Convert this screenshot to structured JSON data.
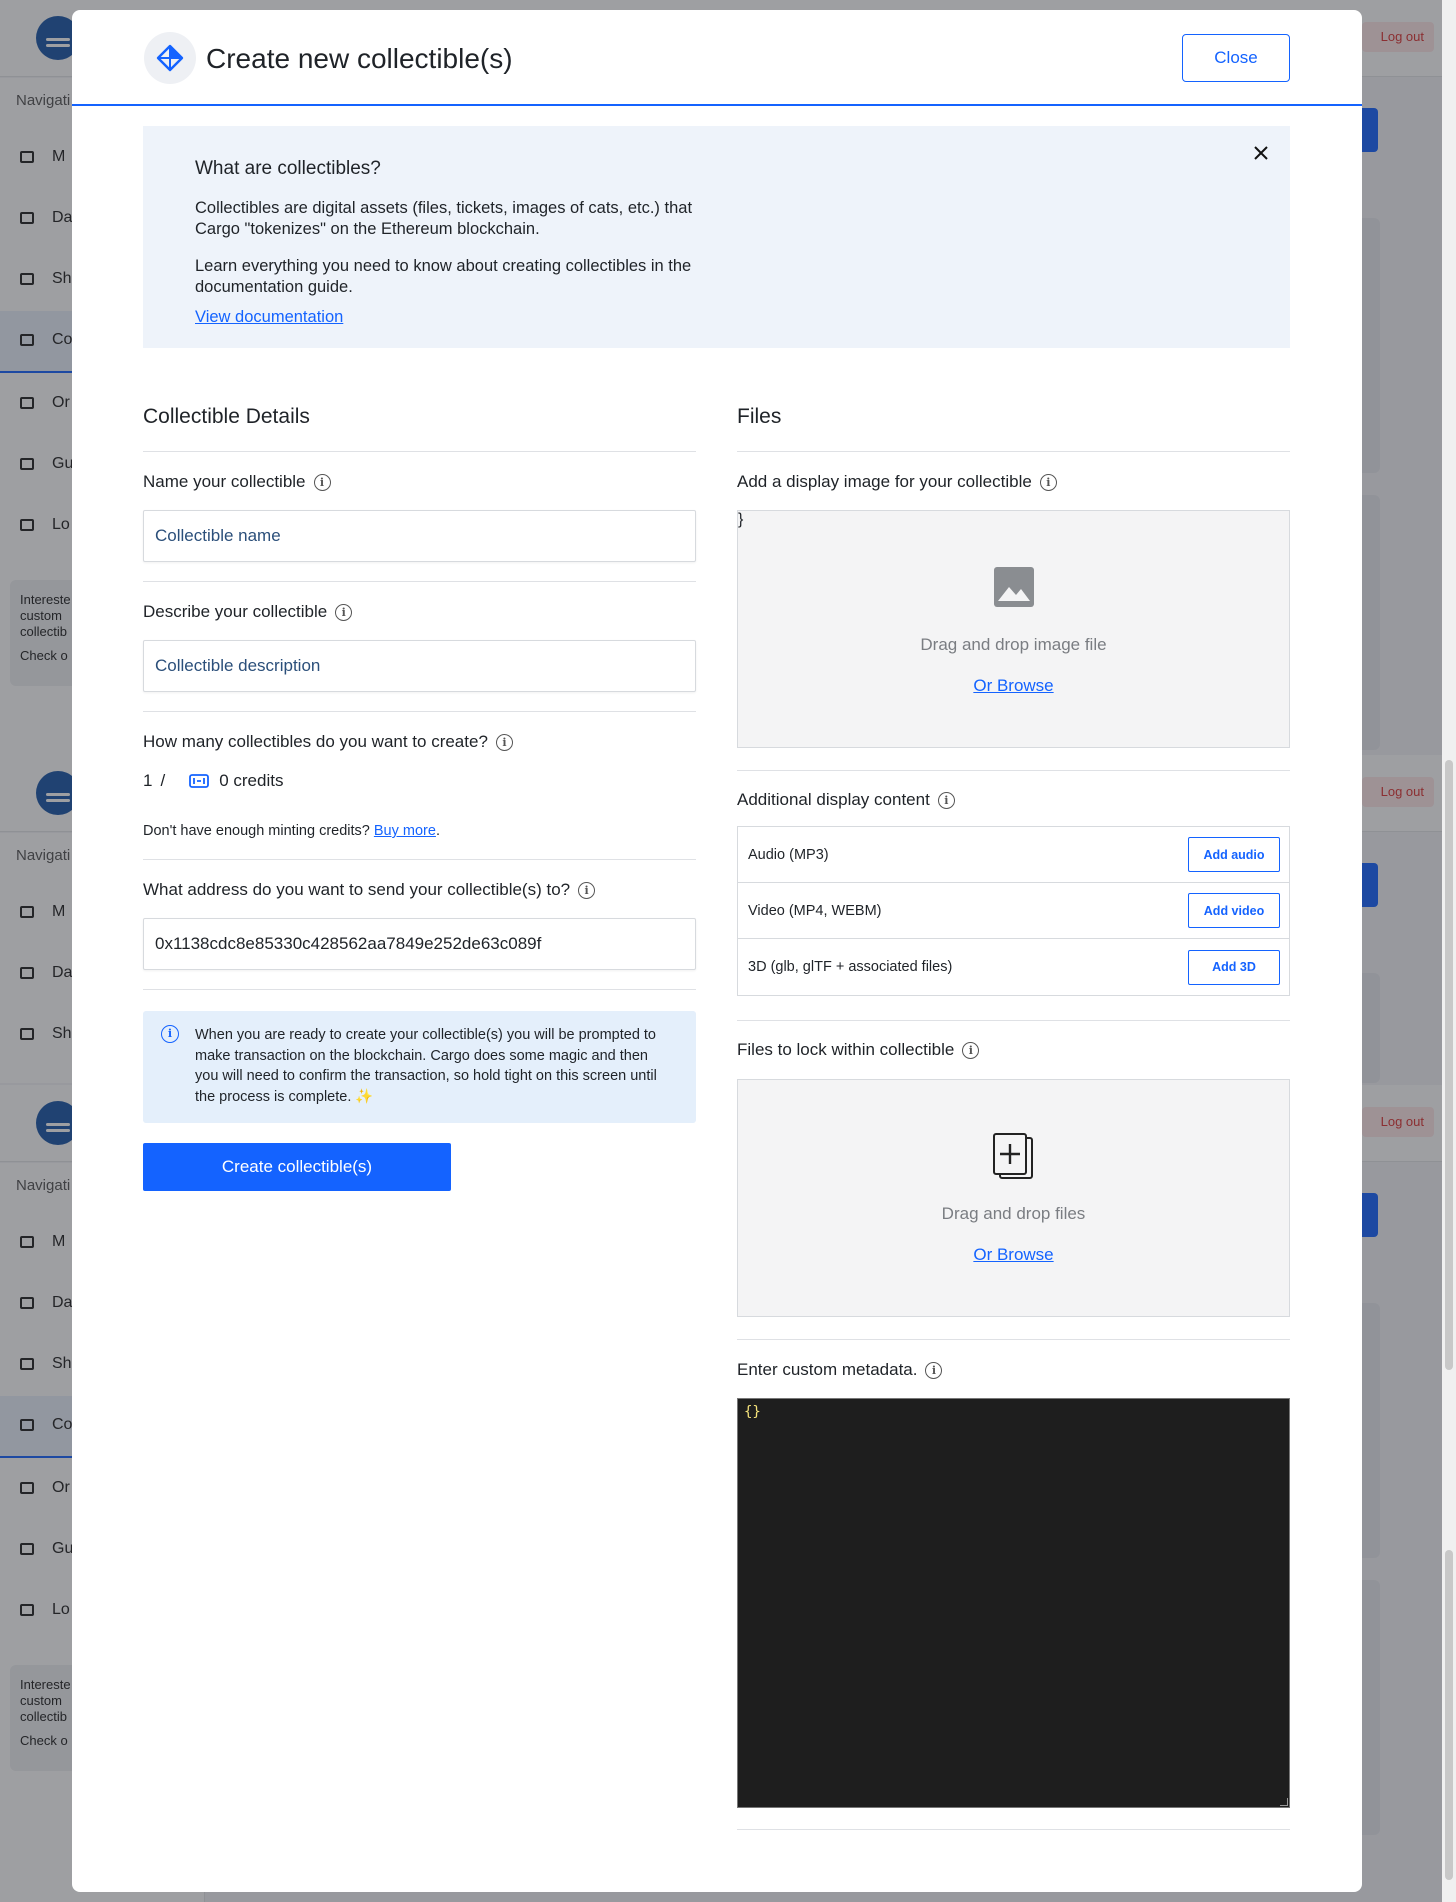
{
  "background": {
    "nav_title": "Navigati",
    "logout_label": "Log out",
    "nav_items": [
      "M",
      "Da",
      "Sh",
      "Co",
      "Or",
      "Gu",
      "Lo"
    ],
    "promo_lines": [
      "Intereste",
      "custom",
      "collectib",
      "Check o"
    ]
  },
  "modal": {
    "title": "Create new collectible(s)",
    "close_label": "Close"
  },
  "info": {
    "title": "What are collectibles?",
    "paragraph_1": "Collectibles are digital assets (files, tickets, images of cats, etc.) that Cargo \"tokenizes\" on the Ethereum blockchain.",
    "paragraph_2": "Learn everything you need to know about creating collectibles in the documentation guide.",
    "link": "View documentation"
  },
  "details": {
    "section_title": "Collectible Details",
    "name_label": "Name your collectible",
    "name_placeholder": "Collectible name",
    "name_value": "",
    "description_label": "Describe your collectible",
    "description_placeholder": "Collectible description",
    "description_value": "",
    "quantity_label": "How many collectibles do you want to create?",
    "quantity_value": "1",
    "quantity_separator": "/",
    "credits_text": "0 credits",
    "minting_note": "Don't have enough minting credits?",
    "buy_more": "Buy more",
    "minting_note_end": ".",
    "address_label": "What address do you want to send your collectible(s) to?",
    "address_value": "0x1138cdc8e85330c428562aa7849e252de63c089f",
    "notice": "When you are ready to create your collectible(s) you will be prompted to make transaction on the blockchain. Cargo does some magic and then you will need to confirm the transaction, so hold tight on this screen until the process is complete. ✨",
    "create_button": "Create collectible(s)"
  },
  "files": {
    "section_title": "Files",
    "display_image_label": "Add a display image for your collectible",
    "image_drop_text": "Drag and drop image file",
    "image_browse": "Or Browse",
    "additional_label": "Additional display content",
    "additional_rows": [
      {
        "label": "Audio (MP3)",
        "button": "Add audio"
      },
      {
        "label": "Video (MP4, WEBM)",
        "button": "Add video"
      },
      {
        "label": "3D (glb, glTF + associated files)",
        "button": "Add 3D"
      }
    ],
    "lock_label": "Files to lock within collectible",
    "files_drop_text": "Drag and drop files",
    "files_browse": "Or Browse",
    "metadata_label": "Enter custom metadata.",
    "metadata_value": "{}"
  },
  "colors": {
    "accent": "#1463ff",
    "info_bg": "#eef3fa",
    "notice_bg": "#e4effb",
    "editor_bg": "#1e1e1e"
  }
}
